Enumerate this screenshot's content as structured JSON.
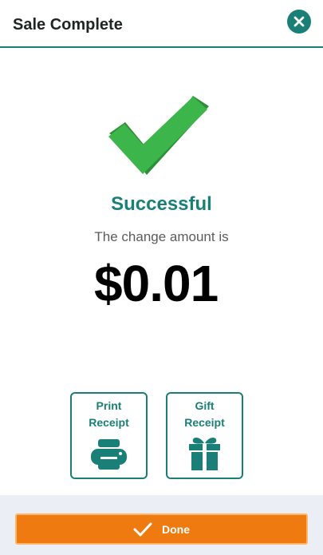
{
  "header": {
    "title": "Sale Complete",
    "close_icon": "close-icon"
  },
  "result": {
    "status": "Successful",
    "message": "The change amount is",
    "amount": "$0.01",
    "icon": "checkmark-icon"
  },
  "receipts": [
    {
      "label": "Print\nReceipt",
      "icon": "printer-icon"
    },
    {
      "label": "Gift\nReceipt",
      "icon": "gift-icon"
    }
  ],
  "footer": {
    "done_label": "Done",
    "done_icon": "check-icon"
  },
  "colors": {
    "accent": "#1a7f76",
    "success": "#3cb54a",
    "done_button": "#ee7a10",
    "footer_bg": "#eceef5"
  }
}
